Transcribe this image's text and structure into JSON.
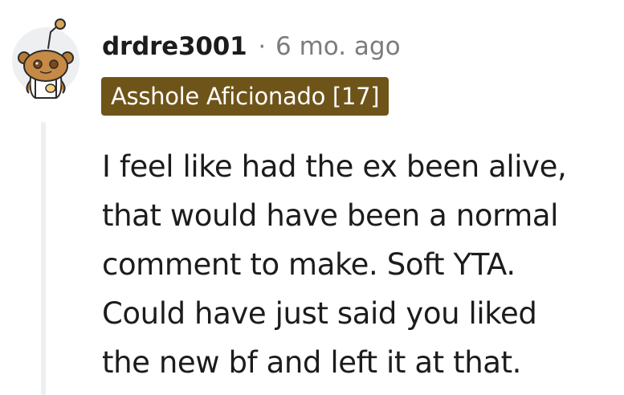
{
  "comment": {
    "username": "drdre3001",
    "separator": "·",
    "timestamp": "6 mo. ago",
    "flair": "Asshole Aficionado [17]",
    "body_lines": [
      "I feel like had the ex been alive,",
      "that would have been a normal",
      "comment to make. Soft YTA.",
      "Could have just said you liked",
      "the new bf and left it at that."
    ]
  },
  "colors": {
    "flair_background": "#6e5418",
    "flair_text": "#ffffff",
    "timestamp": "#7c7c7c",
    "thread_line": "#edeff1"
  },
  "icons": {
    "avatar": "snoo-avatar-icon"
  }
}
